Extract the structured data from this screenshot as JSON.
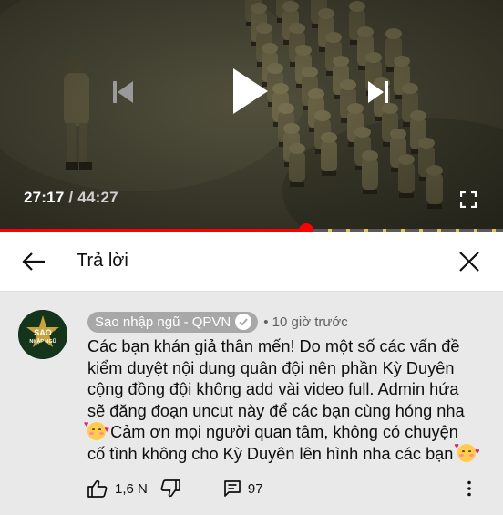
{
  "player": {
    "current_time": "27:17",
    "separator": "/",
    "duration": "44:27",
    "progress_fraction": 0.609,
    "colors": {
      "progress": "#ff0000",
      "chapter_marker": "#e6c34a"
    }
  },
  "header": {
    "title": "Trả lời",
    "back_icon": "arrow-left-icon",
    "close_icon": "close-icon"
  },
  "comment": {
    "avatar_text_top": "SAO",
    "avatar_text_bottom": "NHẬP NGŨ",
    "author": "Sao nhập ngũ - QPVN",
    "time_ago": "• 10 giờ trước",
    "text_lines": [
      "Các bạn khán giả thân mến! Do một số các vấn đề",
      "kiểm duyệt nội dung quân đội nên phần Kỳ Duyên",
      "cộng đồng đội không add vài video full. Admin hứa",
      "sẽ đăng đoạn uncut này để các bạn cùng hóng nha"
    ],
    "text_line5": "Cảm ơn mọi người quan tâm, không có chuyện",
    "text_line6": "cố tình không cho Kỳ Duyên lên hình nha các bạn",
    "like_count": "1,6 N",
    "reply_count": "97"
  }
}
